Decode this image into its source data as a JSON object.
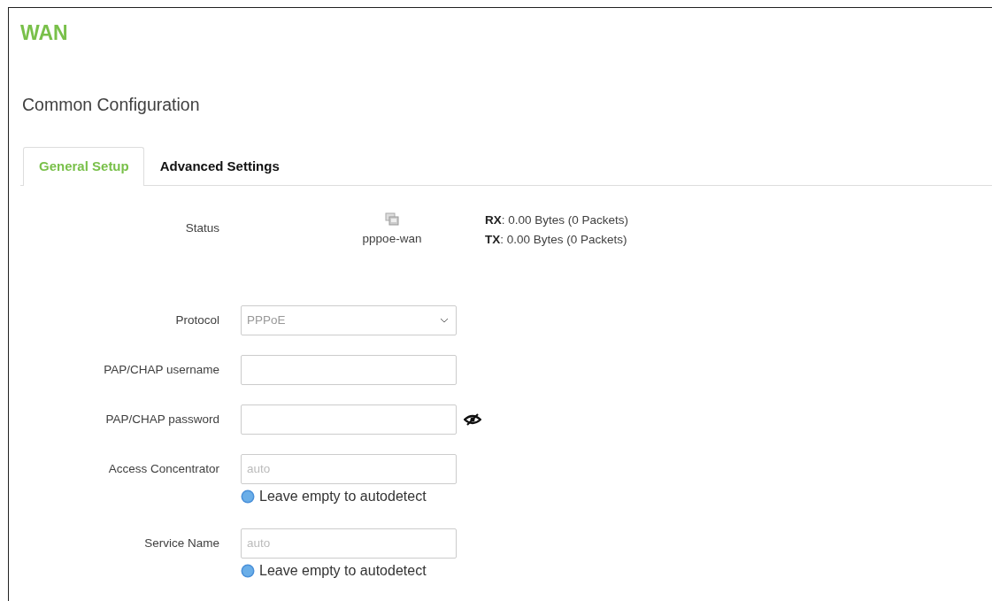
{
  "page_title": "WAN",
  "section_title": "Common Configuration",
  "tabs": [
    {
      "label": "General Setup",
      "selected": true
    },
    {
      "label": "Advanced Settings",
      "selected": false
    }
  ],
  "status": {
    "label": "Status",
    "device": "pppoe-wan",
    "rx_label": "RX",
    "rx_value": ": 0.00 Bytes (0 Packets)",
    "tx_label": "TX",
    "tx_value": ": 0.00 Bytes (0 Packets)"
  },
  "fields": [
    {
      "label": "Protocol",
      "kind": "select",
      "value": "PPPoE"
    },
    {
      "label": "PAP/CHAP username",
      "kind": "text"
    },
    {
      "label": "PAP/CHAP password",
      "kind": "password"
    },
    {
      "label": "Access Concentrator",
      "kind": "text",
      "placeholder": "auto",
      "help": "Leave empty to autodetect"
    },
    {
      "label": "Service Name",
      "kind": "text",
      "placeholder": "auto",
      "help": "Leave empty to autodetect"
    }
  ]
}
